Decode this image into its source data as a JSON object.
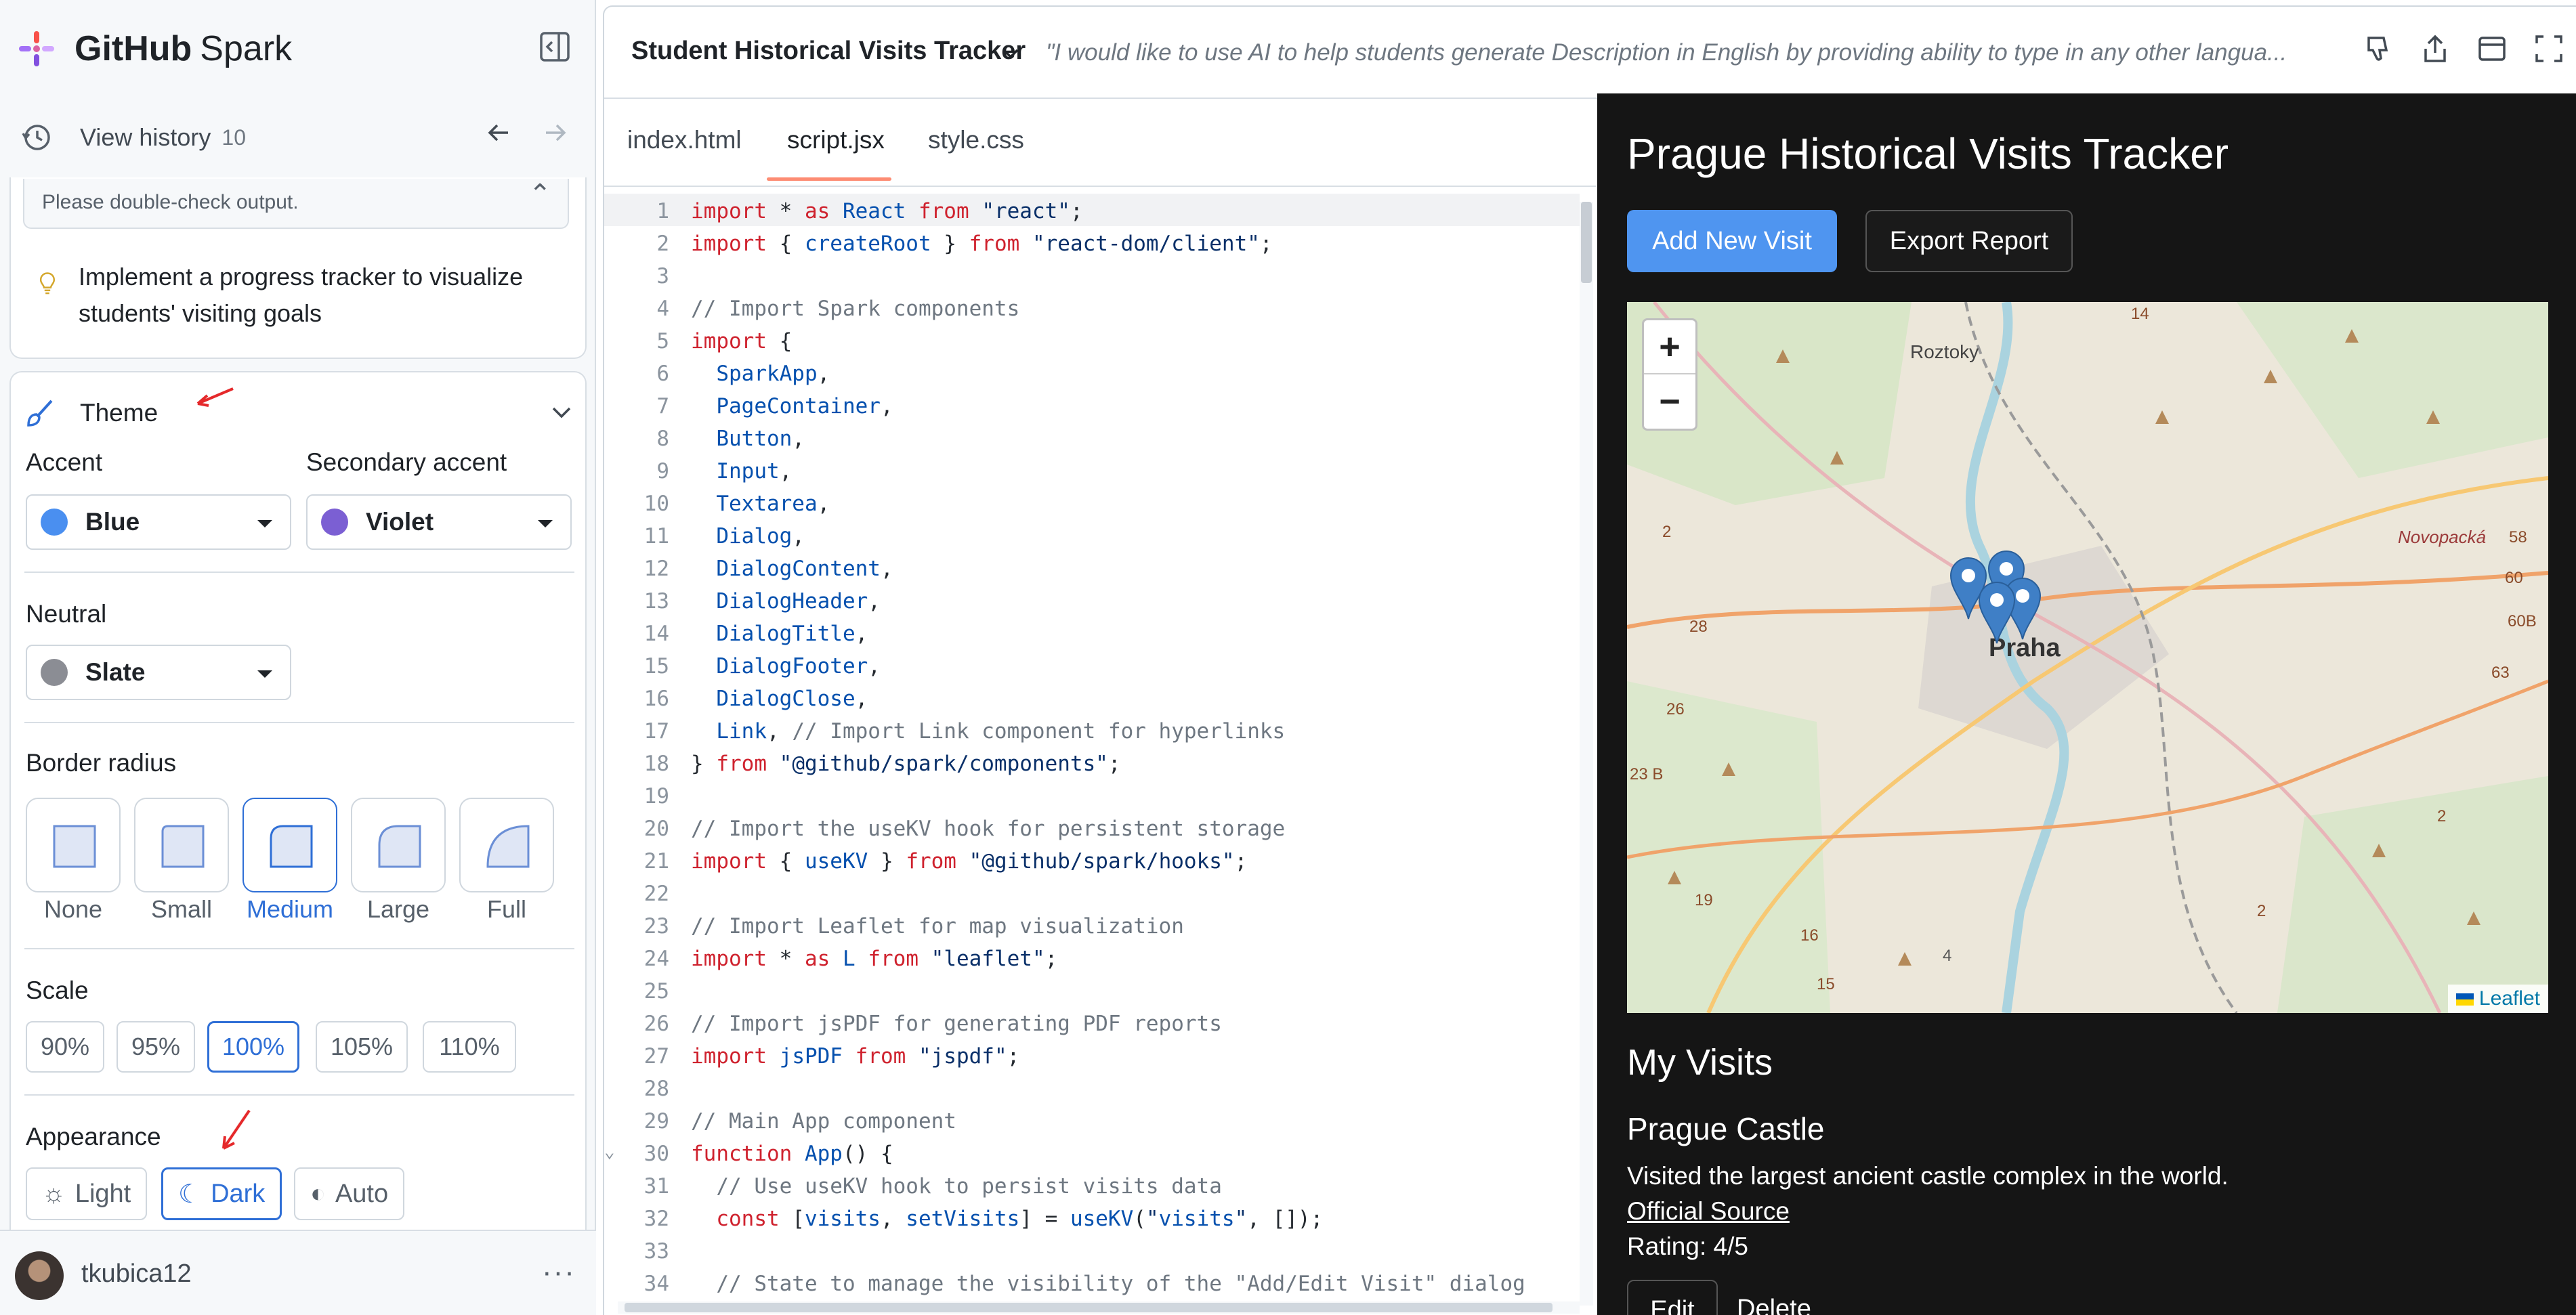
{
  "brand": {
    "name_bold": "GitHub",
    "name_light": "Spark"
  },
  "history": {
    "label": "View history",
    "count": "10"
  },
  "sidebar": {
    "warning": "Please double-check output.",
    "suggestion": "Implement a progress tracker to visualize students' visiting goals"
  },
  "theme": {
    "title": "Theme",
    "accent_label": "Accent",
    "accent_value": "Blue",
    "accent_color": "#4a8ff0",
    "secondary_label": "Secondary accent",
    "secondary_value": "Violet",
    "secondary_color": "#7b5fd3",
    "neutral_label": "Neutral",
    "neutral_value": "Slate",
    "neutral_color": "#8b8d94",
    "radius_label": "Border radius",
    "radius_options": [
      "None",
      "Small",
      "Medium",
      "Large",
      "Full"
    ],
    "radius_selected": "Medium",
    "scale_label": "Scale",
    "scale_options": [
      "90%",
      "95%",
      "100%",
      "105%",
      "110%"
    ],
    "scale_selected": "100%",
    "appearance_label": "Appearance",
    "appearance_options": [
      "Light",
      "Dark",
      "Auto"
    ],
    "appearance_selected": "Dark"
  },
  "user": {
    "name": "tkubica12",
    "more": "···"
  },
  "project": {
    "title": "Student Historical Visits Tracker",
    "prompt": "\"I would like to use AI to help students generate Description in English by providing ability to type in any other langua..."
  },
  "tabs": [
    "index.html",
    "script.jsx",
    "style.css"
  ],
  "active_tab": "script.jsx",
  "code_lines": [
    "import * as React from \"react\";",
    "import { createRoot } from \"react-dom/client\";",
    "",
    "// Import Spark components",
    "import {",
    "  SparkApp,",
    "  PageContainer,",
    "  Button,",
    "  Input,",
    "  Textarea,",
    "  Dialog,",
    "  DialogContent,",
    "  DialogHeader,",
    "  DialogTitle,",
    "  DialogFooter,",
    "  DialogClose,",
    "  Link, // Import Link component for hyperlinks",
    "} from \"@github/spark/components\";",
    "",
    "// Import the useKV hook for persistent storage",
    "import { useKV } from \"@github/spark/hooks\";",
    "",
    "// Import Leaflet for map visualization",
    "import * as L from \"leaflet\";",
    "",
    "// Import jsPDF for generating PDF reports",
    "import jsPDF from \"jspdf\";",
    "",
    "// Main App component",
    "function App() {",
    "  // Use useKV hook to persist visits data",
    "  const [visits, setVisits] = useKV(\"visits\", []);",
    "",
    "  // State to manage the visibility of the \"Add/Edit Visit\" dialog"
  ],
  "preview": {
    "title": "Prague Historical Visits Tracker",
    "add_button": "Add New Visit",
    "export_button": "Export Report",
    "map": {
      "zoom_in": "+",
      "zoom_out": "−",
      "attribution": "Leaflet",
      "city_label": "Praha",
      "district_labels": [
        "Roztoky",
        "Novopacká"
      ],
      "road_numbers": [
        "2",
        "28",
        "26",
        "23 B",
        "19",
        "16",
        "15",
        "4",
        "14",
        "58",
        "60",
        "60B",
        "63",
        "2",
        "2"
      ]
    },
    "my_visits": "My Visits",
    "visit": {
      "name": "Prague Castle",
      "description": "Visited the largest ancient castle complex in the world.",
      "link": "Official Source",
      "rating": "Rating: 4/5",
      "edit": "Edit",
      "delete": "Delete"
    }
  }
}
